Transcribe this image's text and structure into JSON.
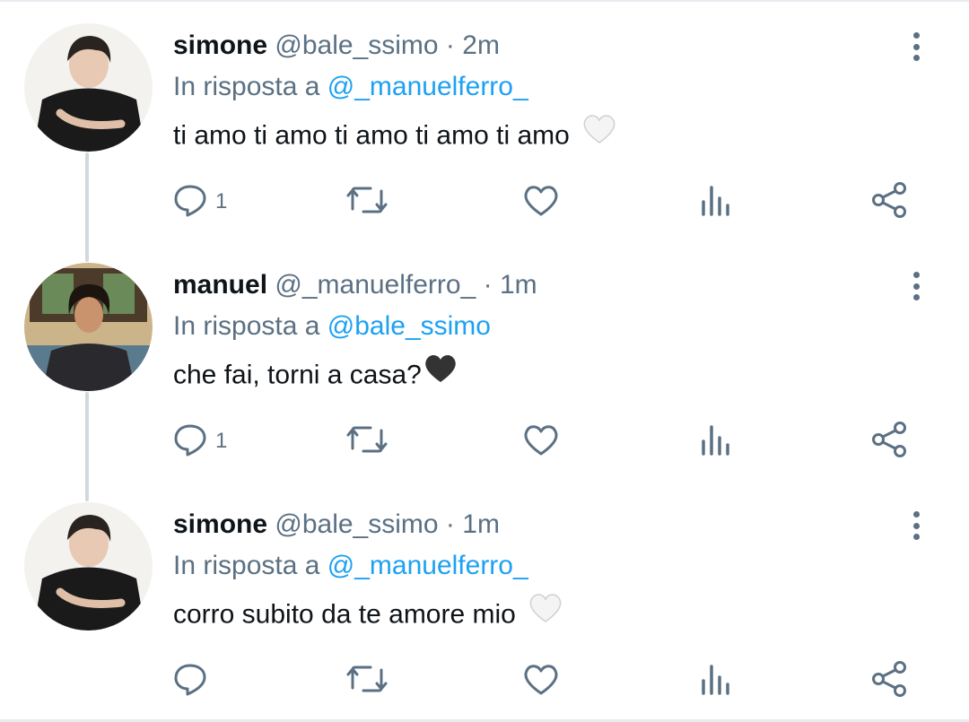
{
  "tweets": [
    {
      "name": "simone",
      "handle": "@bale_ssimo",
      "separator": "·",
      "time": "2m",
      "reply_prefix": "In risposta a",
      "reply_to": "@_manuelferro_",
      "text": "ti amo ti amo ti amo ti amo ti amo",
      "emoji": "white-heart",
      "reply_count": "1",
      "avatar": "simone-avatar"
    },
    {
      "name": "manuel",
      "handle": "@_manuelferro_",
      "separator": "·",
      "time": "1m",
      "reply_prefix": "In risposta a",
      "reply_to": "@bale_ssimo",
      "text": "che fai, torni a casa?",
      "emoji": "black-heart",
      "reply_count": "1",
      "avatar": "manuel-avatar"
    },
    {
      "name": "simone",
      "handle": "@bale_ssimo",
      "separator": "·",
      "time": "1m",
      "reply_prefix": "In risposta a",
      "reply_to": "@_manuelferro_",
      "text": "corro subito da te amore mio",
      "emoji": "white-heart",
      "reply_count": "",
      "avatar": "simone-avatar"
    }
  ],
  "icons": {
    "reply": "reply-icon",
    "retweet": "retweet-icon",
    "like": "like-icon",
    "stats": "stats-icon",
    "share": "share-icon",
    "more": "more-options-icon"
  },
  "colors": {
    "secondary_text": "#5b7083",
    "mention": "#1da1f2",
    "thread_line": "#cfd9de",
    "divider": "#e6ecf0"
  }
}
